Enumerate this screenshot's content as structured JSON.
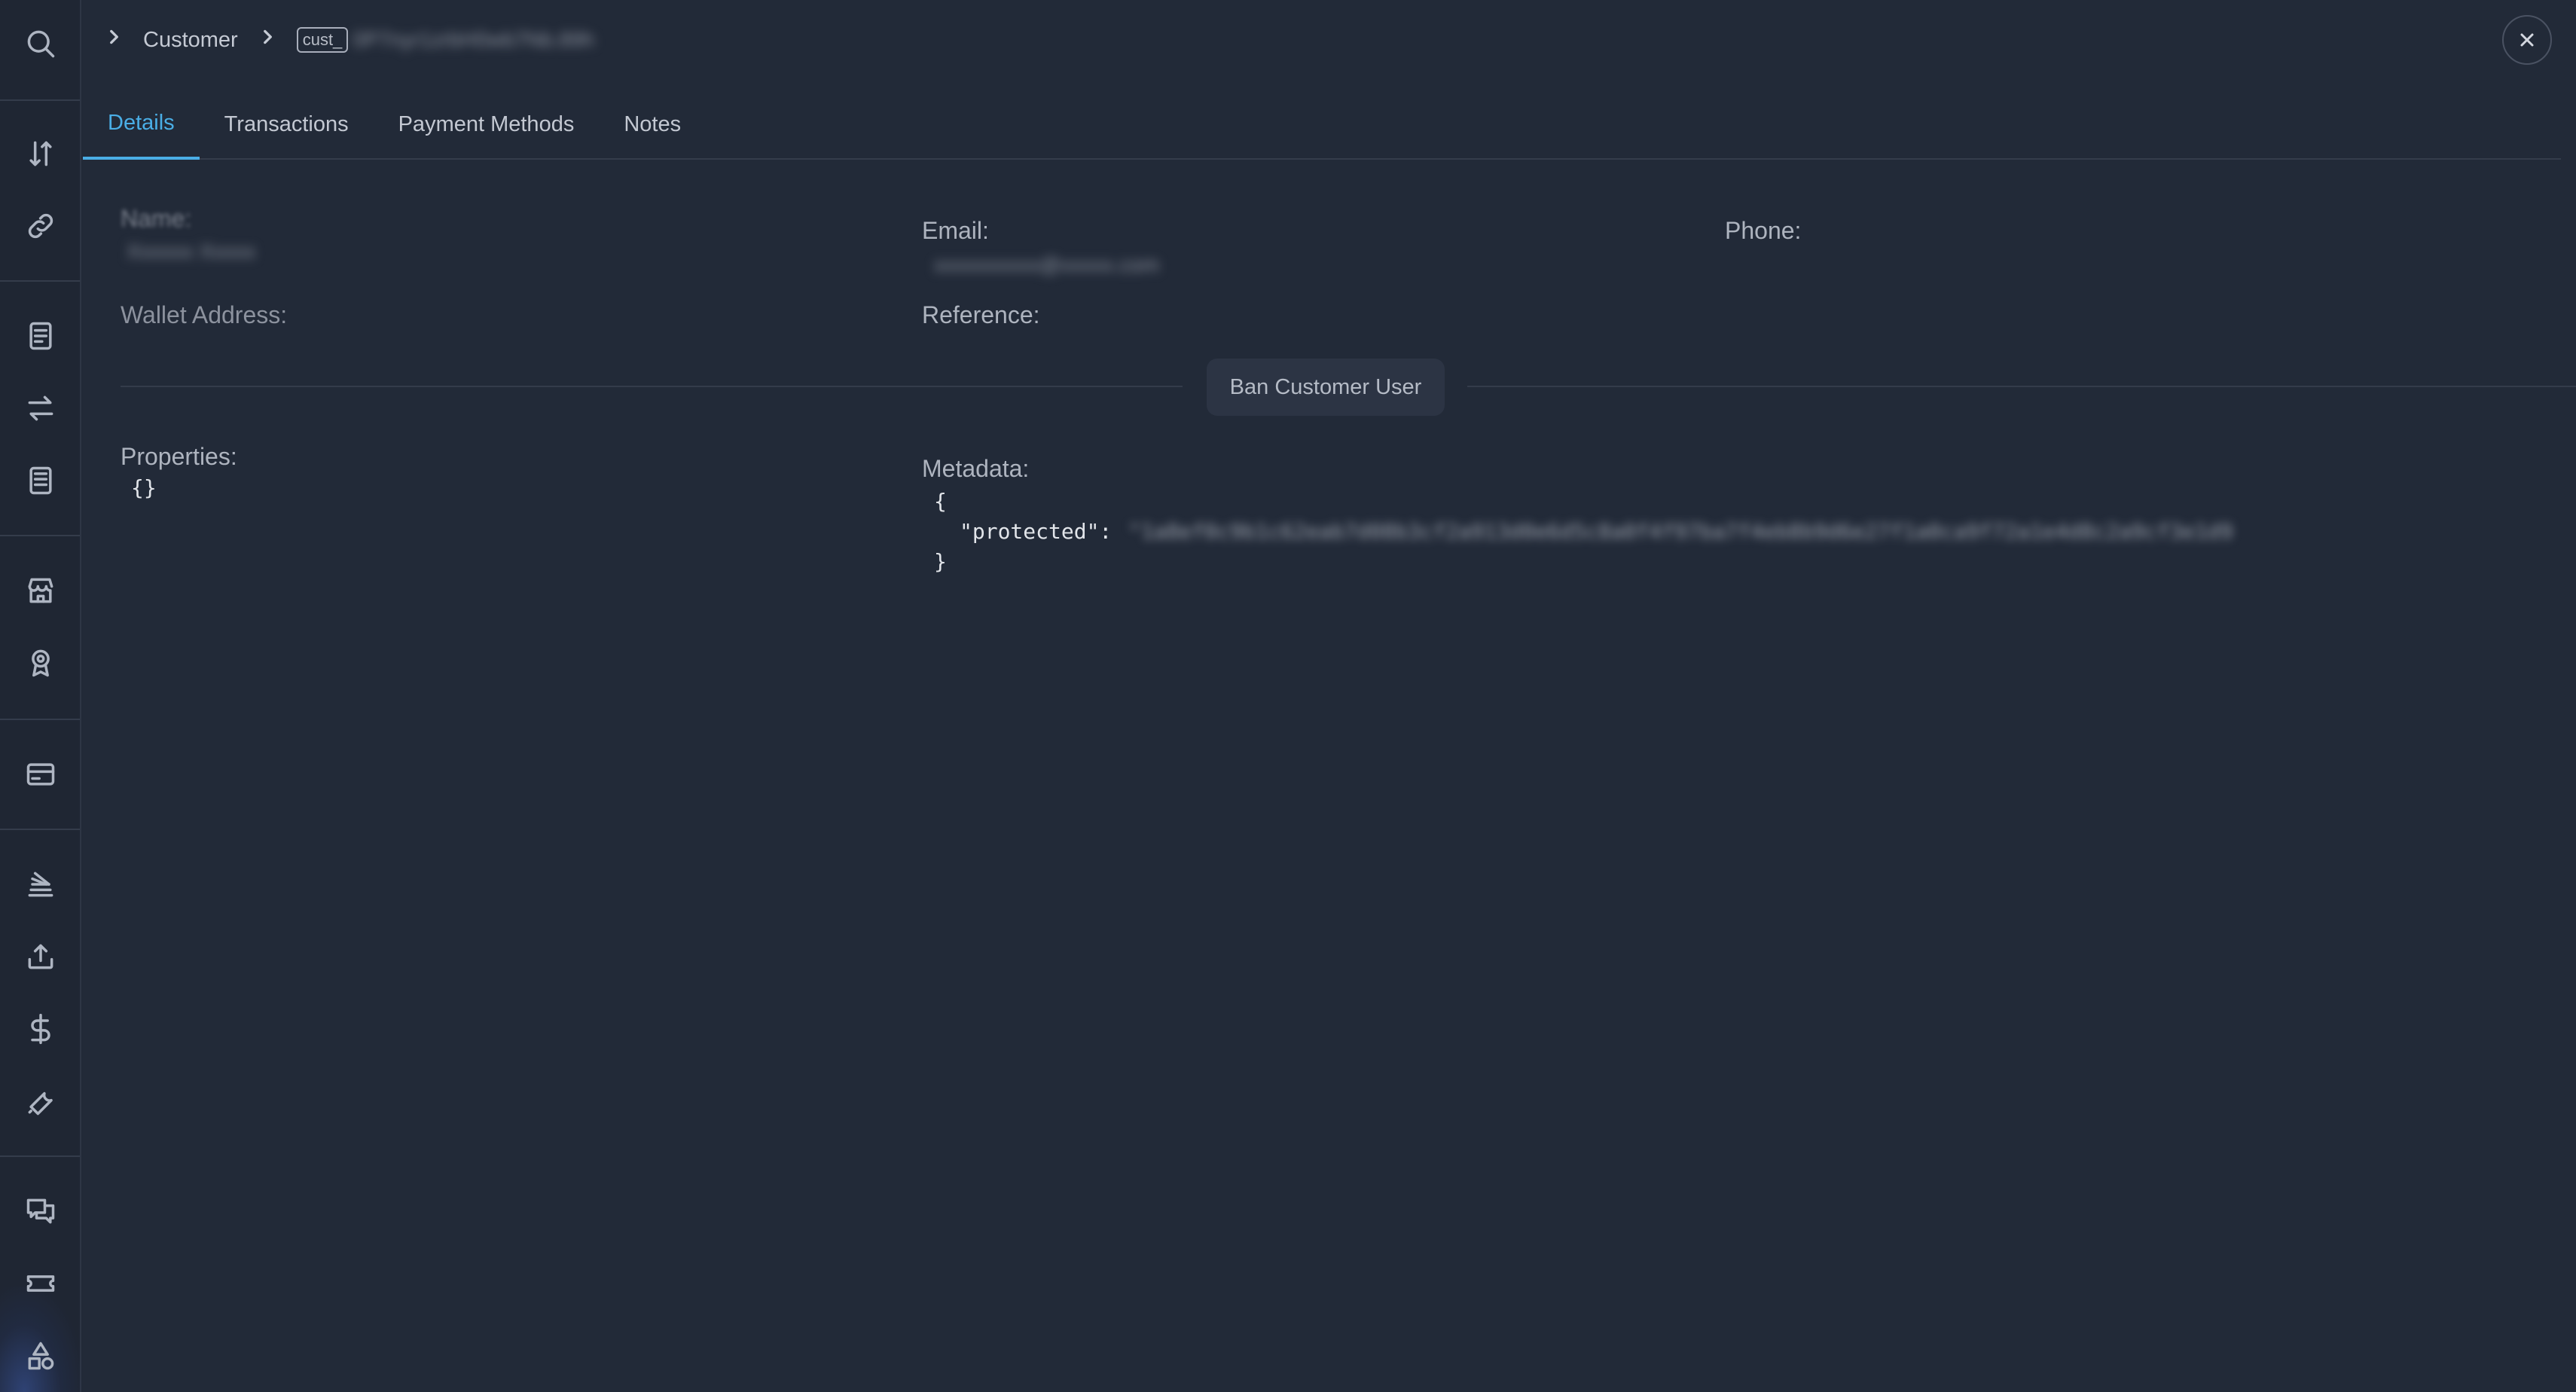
{
  "breadcrumb": {
    "section": "Customer",
    "id_prefix": "cust_",
    "id_rest": "0P7nyr1zrbH0wb7Nb.89h"
  },
  "tabs": [
    {
      "label": "Details",
      "active": true
    },
    {
      "label": "Transactions",
      "active": false
    },
    {
      "label": "Payment Methods",
      "active": false
    },
    {
      "label": "Notes",
      "active": false
    }
  ],
  "details": {
    "name_label": "Name:",
    "name_value": "Xxxxxx Xxxxx",
    "email_label": "Email:",
    "email_value": "xxxxxxxxxx@xxxxx.com",
    "phone_label": "Phone:",
    "wallet_label": "Wallet Address:",
    "reference_label": "Reference:",
    "ban_button": "Ban Customer User",
    "properties_label": "Properties:",
    "properties_value": "{}",
    "metadata_label": "Metadata:",
    "metadata_open": "{",
    "metadata_key": "\"protected\":",
    "metadata_value": "\"1a8ef0c9b1c62eab7d08b3cf2a913d0e6d5c8a0f4f97ba7f4eb8b9d6e27f1a0ca9f72a1e4d8c2a9cf3e1d9",
    "metadata_close": "}"
  },
  "colors": {
    "background": "#222a38",
    "sidebar": "#1f2633",
    "accent": "#4aaee6",
    "button_bg": "#2c3444"
  },
  "sidebar_icons": [
    "search-icon",
    "transfer-icon",
    "link-icon",
    "receipt-icon",
    "exchange-icon",
    "invoice-icon",
    "store-icon",
    "award-icon",
    "card-icon",
    "layers-icon",
    "upload-icon",
    "dollar-icon",
    "wrench-icon",
    "chat-icon",
    "ticket-icon",
    "shapes-icon"
  ]
}
